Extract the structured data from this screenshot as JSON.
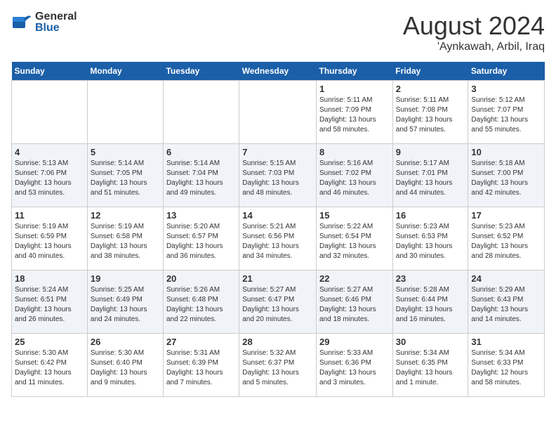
{
  "header": {
    "logo_general": "General",
    "logo_blue": "Blue",
    "month": "August 2024",
    "location": "'Aynkawah, Arbil, Iraq"
  },
  "weekdays": [
    "Sunday",
    "Monday",
    "Tuesday",
    "Wednesday",
    "Thursday",
    "Friday",
    "Saturday"
  ],
  "weeks": [
    [
      {
        "day": "",
        "info": ""
      },
      {
        "day": "",
        "info": ""
      },
      {
        "day": "",
        "info": ""
      },
      {
        "day": "",
        "info": ""
      },
      {
        "day": "1",
        "info": "Sunrise: 5:11 AM\nSunset: 7:09 PM\nDaylight: 13 hours\nand 58 minutes."
      },
      {
        "day": "2",
        "info": "Sunrise: 5:11 AM\nSunset: 7:08 PM\nDaylight: 13 hours\nand 57 minutes."
      },
      {
        "day": "3",
        "info": "Sunrise: 5:12 AM\nSunset: 7:07 PM\nDaylight: 13 hours\nand 55 minutes."
      }
    ],
    [
      {
        "day": "4",
        "info": "Sunrise: 5:13 AM\nSunset: 7:06 PM\nDaylight: 13 hours\nand 53 minutes."
      },
      {
        "day": "5",
        "info": "Sunrise: 5:14 AM\nSunset: 7:05 PM\nDaylight: 13 hours\nand 51 minutes."
      },
      {
        "day": "6",
        "info": "Sunrise: 5:14 AM\nSunset: 7:04 PM\nDaylight: 13 hours\nand 49 minutes."
      },
      {
        "day": "7",
        "info": "Sunrise: 5:15 AM\nSunset: 7:03 PM\nDaylight: 13 hours\nand 48 minutes."
      },
      {
        "day": "8",
        "info": "Sunrise: 5:16 AM\nSunset: 7:02 PM\nDaylight: 13 hours\nand 46 minutes."
      },
      {
        "day": "9",
        "info": "Sunrise: 5:17 AM\nSunset: 7:01 PM\nDaylight: 13 hours\nand 44 minutes."
      },
      {
        "day": "10",
        "info": "Sunrise: 5:18 AM\nSunset: 7:00 PM\nDaylight: 13 hours\nand 42 minutes."
      }
    ],
    [
      {
        "day": "11",
        "info": "Sunrise: 5:19 AM\nSunset: 6:59 PM\nDaylight: 13 hours\nand 40 minutes."
      },
      {
        "day": "12",
        "info": "Sunrise: 5:19 AM\nSunset: 6:58 PM\nDaylight: 13 hours\nand 38 minutes."
      },
      {
        "day": "13",
        "info": "Sunrise: 5:20 AM\nSunset: 6:57 PM\nDaylight: 13 hours\nand 36 minutes."
      },
      {
        "day": "14",
        "info": "Sunrise: 5:21 AM\nSunset: 6:56 PM\nDaylight: 13 hours\nand 34 minutes."
      },
      {
        "day": "15",
        "info": "Sunrise: 5:22 AM\nSunset: 6:54 PM\nDaylight: 13 hours\nand 32 minutes."
      },
      {
        "day": "16",
        "info": "Sunrise: 5:23 AM\nSunset: 6:53 PM\nDaylight: 13 hours\nand 30 minutes."
      },
      {
        "day": "17",
        "info": "Sunrise: 5:23 AM\nSunset: 6:52 PM\nDaylight: 13 hours\nand 28 minutes."
      }
    ],
    [
      {
        "day": "18",
        "info": "Sunrise: 5:24 AM\nSunset: 6:51 PM\nDaylight: 13 hours\nand 26 minutes."
      },
      {
        "day": "19",
        "info": "Sunrise: 5:25 AM\nSunset: 6:49 PM\nDaylight: 13 hours\nand 24 minutes."
      },
      {
        "day": "20",
        "info": "Sunrise: 5:26 AM\nSunset: 6:48 PM\nDaylight: 13 hours\nand 22 minutes."
      },
      {
        "day": "21",
        "info": "Sunrise: 5:27 AM\nSunset: 6:47 PM\nDaylight: 13 hours\nand 20 minutes."
      },
      {
        "day": "22",
        "info": "Sunrise: 5:27 AM\nSunset: 6:46 PM\nDaylight: 13 hours\nand 18 minutes."
      },
      {
        "day": "23",
        "info": "Sunrise: 5:28 AM\nSunset: 6:44 PM\nDaylight: 13 hours\nand 16 minutes."
      },
      {
        "day": "24",
        "info": "Sunrise: 5:29 AM\nSunset: 6:43 PM\nDaylight: 13 hours\nand 14 minutes."
      }
    ],
    [
      {
        "day": "25",
        "info": "Sunrise: 5:30 AM\nSunset: 6:42 PM\nDaylight: 13 hours\nand 11 minutes."
      },
      {
        "day": "26",
        "info": "Sunrise: 5:30 AM\nSunset: 6:40 PM\nDaylight: 13 hours\nand 9 minutes."
      },
      {
        "day": "27",
        "info": "Sunrise: 5:31 AM\nSunset: 6:39 PM\nDaylight: 13 hours\nand 7 minutes."
      },
      {
        "day": "28",
        "info": "Sunrise: 5:32 AM\nSunset: 6:37 PM\nDaylight: 13 hours\nand 5 minutes."
      },
      {
        "day": "29",
        "info": "Sunrise: 5:33 AM\nSunset: 6:36 PM\nDaylight: 13 hours\nand 3 minutes."
      },
      {
        "day": "30",
        "info": "Sunrise: 5:34 AM\nSunset: 6:35 PM\nDaylight: 13 hours\nand 1 minute."
      },
      {
        "day": "31",
        "info": "Sunrise: 5:34 AM\nSunset: 6:33 PM\nDaylight: 12 hours\nand 58 minutes."
      }
    ]
  ]
}
